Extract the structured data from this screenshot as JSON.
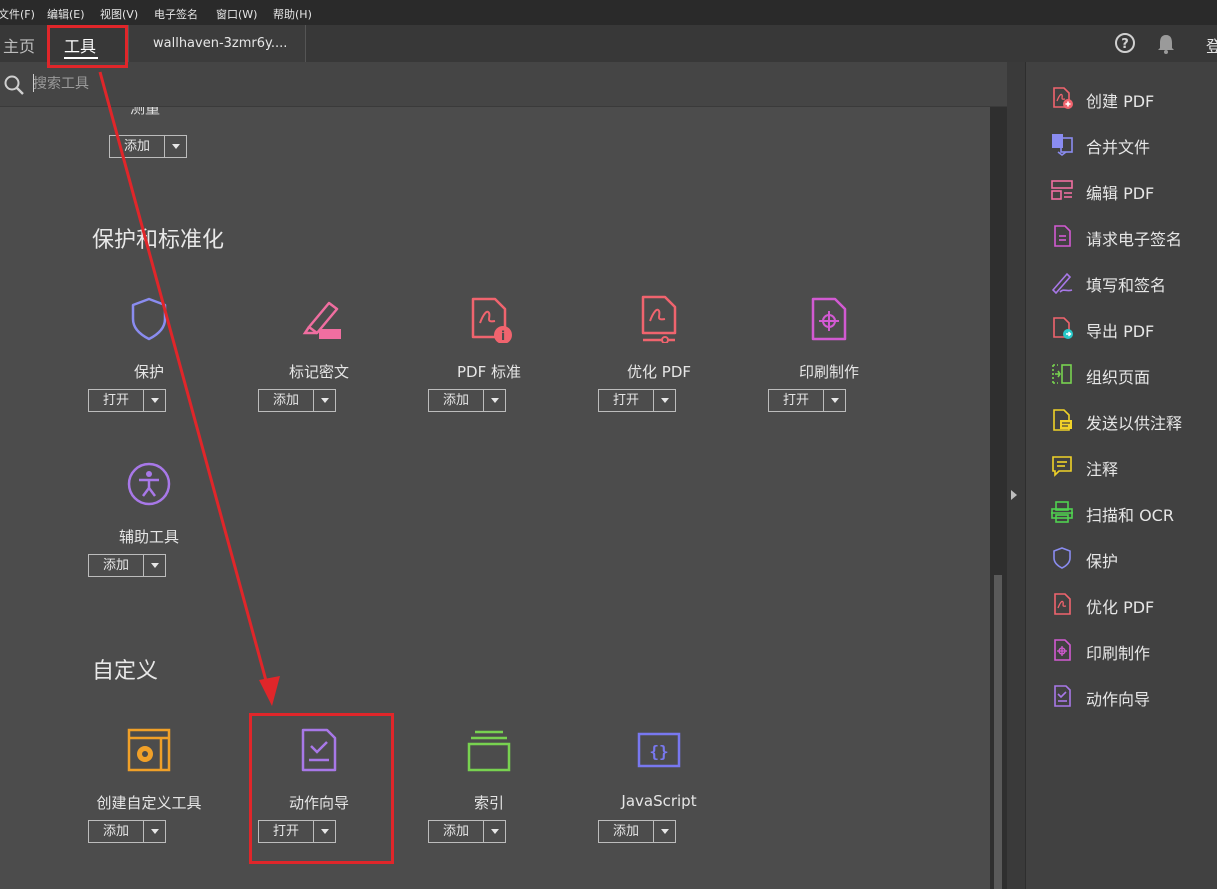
{
  "menubar": {
    "items": [
      "文件(F)",
      "编辑(E)",
      "视图(V)",
      "电子签名",
      "窗口(W)",
      "帮助(H)"
    ]
  },
  "tabbar": {
    "home": "主页",
    "tools": "工具",
    "doc": "wallhaven-3zmr6y....",
    "login": "登"
  },
  "search": {
    "placeholder": "搜索工具"
  },
  "top_cut": {
    "label": "测量",
    "button": "添加"
  },
  "sections": [
    {
      "title": "保护和标准化",
      "tools": [
        {
          "name": "保护",
          "button": "打开",
          "icon": "shield-icon"
        },
        {
          "name": "标记密文",
          "button": "添加",
          "icon": "redact-marker-icon"
        },
        {
          "name": "PDF 标准",
          "button": "添加",
          "icon": "pdf-standards-icon"
        },
        {
          "name": "优化 PDF",
          "button": "打开",
          "icon": "optimize-pdf-icon"
        },
        {
          "name": "印刷制作",
          "button": "打开",
          "icon": "print-production-icon"
        },
        {
          "name": "辅助工具",
          "button": "添加",
          "icon": "accessibility-icon"
        }
      ]
    },
    {
      "title": "自定义",
      "tools": [
        {
          "name": "创建自定义工具",
          "button": "添加",
          "icon": "custom-tool-icon"
        },
        {
          "name": "动作向导",
          "button": "打开",
          "icon": "action-wizard-icon"
        },
        {
          "name": "索引",
          "button": "添加",
          "icon": "index-icon"
        },
        {
          "name": "JavaScript",
          "button": "添加",
          "icon": "javascript-icon"
        }
      ]
    }
  ],
  "right_pane": {
    "items": [
      {
        "label": "创建 PDF",
        "icon": "create-pdf-icon"
      },
      {
        "label": "合并文件",
        "icon": "combine-files-icon"
      },
      {
        "label": "编辑 PDF",
        "icon": "edit-pdf-icon"
      },
      {
        "label": "请求电子签名",
        "icon": "request-signature-icon"
      },
      {
        "label": "填写和签名",
        "icon": "fill-sign-icon"
      },
      {
        "label": "导出 PDF",
        "icon": "export-pdf-icon"
      },
      {
        "label": "组织页面",
        "icon": "organize-pages-icon"
      },
      {
        "label": "发送以供注释",
        "icon": "send-comments-icon"
      },
      {
        "label": "注释",
        "icon": "comment-icon"
      },
      {
        "label": "扫描和 OCR",
        "icon": "scan-ocr-icon"
      },
      {
        "label": "保护",
        "icon": "shield-icon"
      },
      {
        "label": "优化 PDF",
        "icon": "optimize-pdf-icon"
      },
      {
        "label": "印刷制作",
        "icon": "print-production-icon"
      },
      {
        "label": "动作向导",
        "icon": "action-wizard-icon"
      }
    ]
  },
  "colors": {
    "shield": "#8a8cf0",
    "redact": "#f06ea0",
    "pdf_red": "#f0646e",
    "print": "#d25ad2",
    "accessibility": "#a878e8",
    "custom": "#f0a028",
    "index": "#78d250",
    "javascript": "#7878f0",
    "annotation_red": "#e0262a"
  }
}
